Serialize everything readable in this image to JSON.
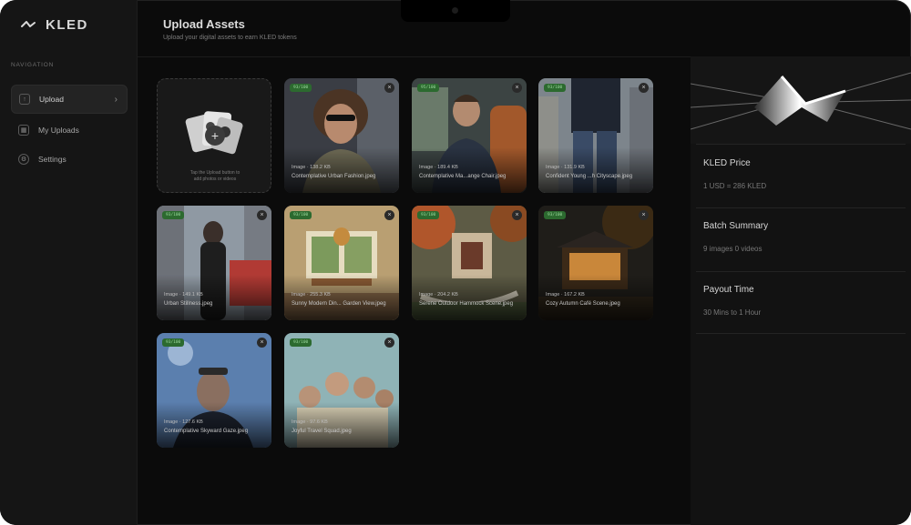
{
  "app": {
    "brand": "KLED"
  },
  "sidebar": {
    "heading": "NAVIGATION",
    "items": [
      {
        "label": "Upload",
        "active": true,
        "icon": "upload-icon"
      },
      {
        "label": "My Uploads",
        "active": false,
        "icon": "grid-icon"
      },
      {
        "label": "Settings",
        "active": false,
        "icon": "gear-icon"
      }
    ]
  },
  "header": {
    "title": "Upload Assets",
    "subtitle": "Upload your digital assets to earn KLED tokens"
  },
  "upload_tile": {
    "hint_line1": "Tap the Upload button to",
    "hint_line2": "add photos or videos"
  },
  "assets": [
    {
      "badge": "93/100",
      "meta": "Image · 138.2 KB",
      "name": "Contemplative Urban Fashion.jpeg"
    },
    {
      "badge": "95/100",
      "meta": "Image · 189.4 KB",
      "name": "Contemplative Ma...ange Chair.jpeg"
    },
    {
      "badge": "93/100",
      "meta": "Image · 131.9 KB",
      "name": "Confident Young ...h Cityscape.jpeg"
    },
    {
      "badge": "93/100",
      "meta": "Image · 149.1 KB",
      "name": "Urban Stillness.jpeg"
    },
    {
      "badge": "93/100",
      "meta": "Image · 255.3 KB",
      "name": "Sunny Modern Din... Garden View.jpeg"
    },
    {
      "badge": "93/100",
      "meta": "Image · 204.2 KB",
      "name": "Serene Outdoor Hammock Scene.jpeg"
    },
    {
      "badge": "93/100",
      "meta": "Image · 167.2 KB",
      "name": "Cozy Autumn Café Scene.jpeg"
    },
    {
      "badge": "93/100",
      "meta": "Image · 127.6 KB",
      "name": "Contemplative Skyward Gaze.jpeg"
    },
    {
      "badge": "93/100",
      "meta": "Image · 97.6 KB",
      "name": "Joyful Travel Squad.jpeg"
    }
  ],
  "summary": {
    "price_title": "KLED Price",
    "price_value": "1 USD = 286 KLED",
    "batch_title": "Batch Summary",
    "batch_value": "9 images 0 videos",
    "payout_title": "Payout Time",
    "payout_value": "30 Mins to 1 Hour"
  },
  "colors": {
    "background": "#0b0b0b",
    "sidebar": "#151515",
    "badge": "#2c6a2f"
  }
}
